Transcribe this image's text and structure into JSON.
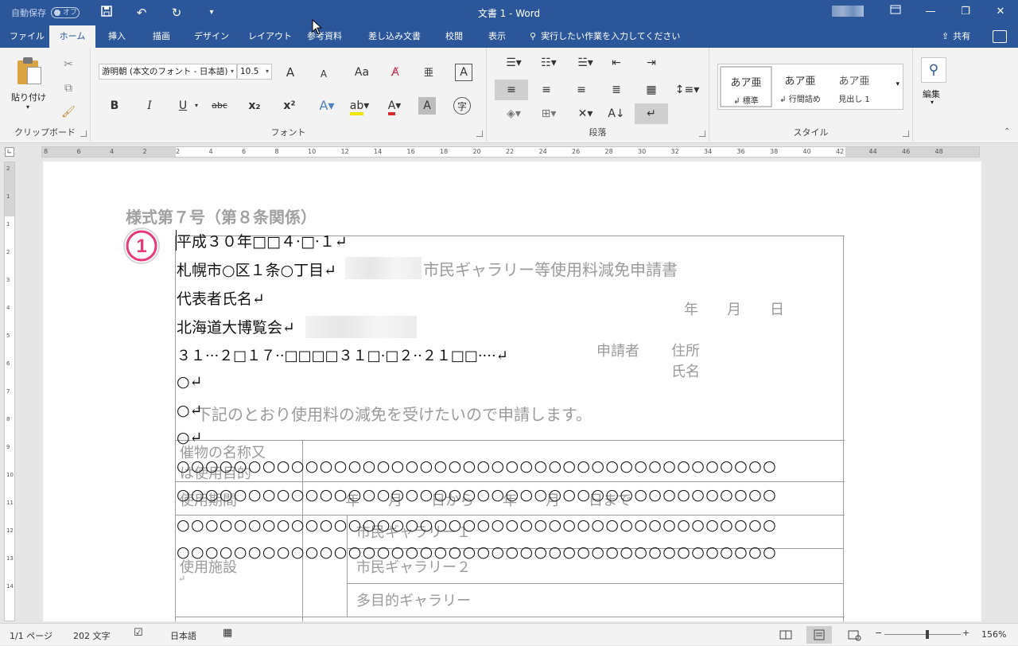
{
  "titlebar": {
    "autosave_label": "自動保存",
    "autosave_state": "オフ",
    "doc_title": "文書 1 - Word"
  },
  "tabs": [
    "ファイル",
    "ホーム",
    "挿入",
    "描画",
    "デザイン",
    "レイアウト",
    "参考資料",
    "差し込み文書",
    "校閲",
    "表示"
  ],
  "tellme_placeholder": "実行したい作業を入力してください",
  "share_label": "共有",
  "ribbon": {
    "clipboard": {
      "paste_label": "貼り付け",
      "group_label": "クリップボード"
    },
    "font": {
      "font_name": "游明朝 (本文のフォント - 日本語)",
      "font_size": "10.5",
      "group_label": "フォント",
      "grow": "A",
      "shrink": "A",
      "case": "Aa",
      "bold": "B",
      "italic": "I",
      "underline": "U",
      "strike": "abc",
      "sub": "x₂",
      "sup": "x²"
    },
    "paragraph": {
      "group_label": "段落"
    },
    "styles": {
      "group_label": "スタイル",
      "items": [
        {
          "preview": "あア亜",
          "name": "↲ 標準"
        },
        {
          "preview": "あア亜",
          "name": "↲ 行間詰め"
        },
        {
          "preview": "あア亜",
          "name": "見出し 1"
        }
      ]
    },
    "editing": {
      "label": "編集"
    }
  },
  "ruler_ticks": [
    "8",
    "6",
    "4",
    "2",
    "2",
    "4",
    "6",
    "8",
    "10",
    "12",
    "14",
    "16",
    "18",
    "20",
    "22",
    "24",
    "26",
    "28",
    "30",
    "32",
    "34",
    "36",
    "38",
    "40",
    "42",
    "44",
    "46",
    "48"
  ],
  "vruler_ticks": [
    "2",
    "1",
    "1",
    "2",
    "3",
    "4",
    "5",
    "6",
    "7",
    "8",
    "9",
    "10",
    "11",
    "12",
    "13",
    "14"
  ],
  "document": {
    "form_heading": "様式第７号（第８条関係）",
    "form_title": "市民ギャラリー等使用料減免申請書",
    "date_line": "年　　月　　日",
    "applicant_label": "申請者",
    "address_label": "住所",
    "name_label": "氏名",
    "request_text": "下記のとおり使用料の減免を受けたいので申請します。",
    "row1_label": "催物の名称又",
    "row1_label2": "は使用目的",
    "row2_label": "使用期間",
    "row2_value": "年　　月　　日から　　年　　月　　日まで",
    "row3_label": "使用施設",
    "facility1": "市民ギャラリー１",
    "facility2": "市民ギャラリー２",
    "facility3": "多目的ギャラリー",
    "inserted_lines": [
      "平成３０年□□４·□·１↵",
      "札幌市○区１条○丁目↵",
      "代表者氏名↵",
      "北海道大博覧会↵",
      "３１···２□１７··□□□□３１□·□２··２１□□····↵",
      "○↵",
      "○↵",
      "○↵"
    ],
    "circles_row": "○○○○○○○○○○○○○○○○○○○○○○○○○○○○○○○○○○○○○○○○○○",
    "badge_number": "1"
  },
  "status": {
    "page": "1/1 ページ",
    "words": "202 文字",
    "lang": "日本語",
    "zoom": "156%"
  },
  "colors": {
    "accent": "#2b579a",
    "badge": "#e5397a"
  }
}
